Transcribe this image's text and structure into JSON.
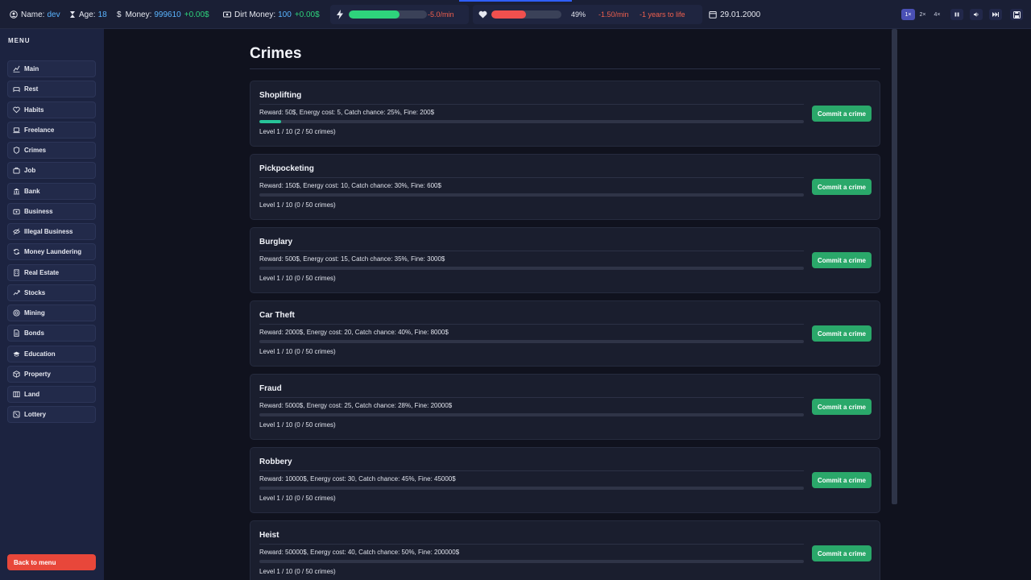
{
  "header": {
    "name_label": "Name:",
    "name_value": "dev",
    "age_label": "Age:",
    "age_value": "18",
    "money_label": "Money:",
    "money_value": "999610",
    "money_delta": "+0.00$",
    "dirt_label": "Dirt Money:",
    "dirt_value": "100",
    "dirt_delta": "+0.00$",
    "energy_rate": "-5.0/min",
    "energy_level": 0.65,
    "health_percent": "49%",
    "health_level": 0.49,
    "health_rate": "-1.50/min",
    "health_life": "-1 years to life",
    "date": "29.01.2000",
    "speeds": [
      "1×",
      "2×",
      "4×"
    ],
    "colors": {
      "energy": "#2ed37c",
      "health": "#f0504e",
      "accent": "#4a50b5"
    }
  },
  "sidebar": {
    "title": "MENU",
    "items": [
      {
        "label": "Main",
        "icon": "chart-line-icon"
      },
      {
        "label": "Rest",
        "icon": "bed-icon"
      },
      {
        "label": "Habits",
        "icon": "heart-icon"
      },
      {
        "label": "Freelance",
        "icon": "laptop-icon"
      },
      {
        "label": "Crimes",
        "icon": "shield-icon"
      },
      {
        "label": "Job",
        "icon": "briefcase-icon"
      },
      {
        "label": "Bank",
        "icon": "bank-icon"
      },
      {
        "label": "Business",
        "icon": "store-icon"
      },
      {
        "label": "Illegal Business",
        "icon": "eye-icon"
      },
      {
        "label": "Money Laundering",
        "icon": "refresh-icon"
      },
      {
        "label": "Real Estate",
        "icon": "building-icon"
      },
      {
        "label": "Stocks",
        "icon": "stocks-icon"
      },
      {
        "label": "Mining",
        "icon": "coin-icon"
      },
      {
        "label": "Bonds",
        "icon": "document-icon"
      },
      {
        "label": "Education",
        "icon": "graduation-icon"
      },
      {
        "label": "Property",
        "icon": "box-icon"
      },
      {
        "label": "Land",
        "icon": "map-icon"
      },
      {
        "label": "Lottery",
        "icon": "dice-icon"
      }
    ],
    "back_label": "Back to menu"
  },
  "main": {
    "title": "Crimes",
    "button_label": "Commit a crime",
    "crimes": [
      {
        "name": "Shoplifting",
        "desc": "Reward: 50$, Energy cost: 5, Catch chance: 25%, Fine: 200$",
        "level": "Level 1 / 10 (2 / 50 crimes)",
        "progress": 0.04
      },
      {
        "name": "Pickpocketing",
        "desc": "Reward: 150$, Energy cost: 10, Catch chance: 30%, Fine: 600$",
        "level": "Level 1 / 10 (0 / 50 crimes)",
        "progress": 0
      },
      {
        "name": "Burglary",
        "desc": "Reward: 500$, Energy cost: 15, Catch chance: 35%, Fine: 3000$",
        "level": "Level 1 / 10 (0 / 50 crimes)",
        "progress": 0
      },
      {
        "name": "Car Theft",
        "desc": "Reward: 2000$, Energy cost: 20, Catch chance: 40%, Fine: 8000$",
        "level": "Level 1 / 10 (0 / 50 crimes)",
        "progress": 0
      },
      {
        "name": "Fraud",
        "desc": "Reward: 5000$, Energy cost: 25, Catch chance: 28%, Fine: 20000$",
        "level": "Level 1 / 10 (0 / 50 crimes)",
        "progress": 0
      },
      {
        "name": "Robbery",
        "desc": "Reward: 10000$, Energy cost: 30, Catch chance: 45%, Fine: 45000$",
        "level": "Level 1 / 10 (0 / 50 crimes)",
        "progress": 0
      },
      {
        "name": "Heist",
        "desc": "Reward: 50000$, Energy cost: 40, Catch chance: 50%, Fine: 200000$",
        "level": "Level 1 / 10 (0 / 50 crimes)",
        "progress": 0
      }
    ]
  }
}
